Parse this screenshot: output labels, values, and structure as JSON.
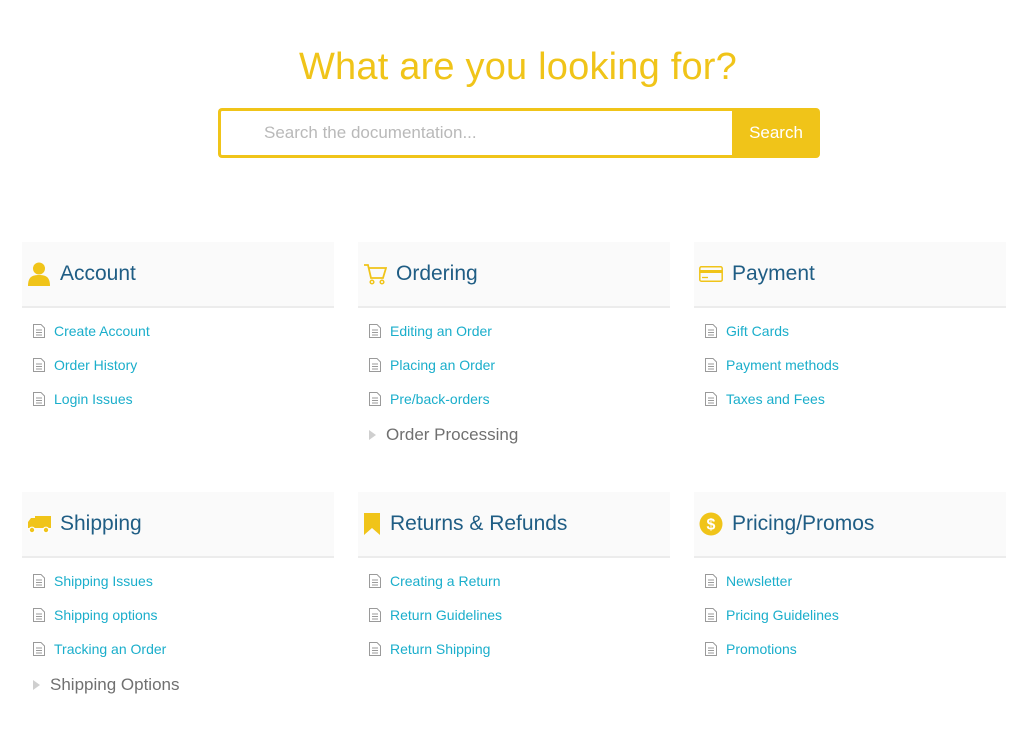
{
  "hero": {
    "title": "What are you looking for?",
    "search_placeholder": "Search the documentation...",
    "search_button": "Search"
  },
  "colors": {
    "accent": "#f0c419",
    "heading": "#1f5d84",
    "link": "#1aaecb",
    "muted": "#707070"
  },
  "categories": [
    {
      "title": "Account",
      "icon": "user-icon",
      "articles": [
        "Create Account",
        "Order History",
        "Login Issues"
      ]
    },
    {
      "title": "Ordering",
      "icon": "cart-icon",
      "articles": [
        "Editing an Order",
        "Placing an Order",
        "Pre/back-orders"
      ],
      "subsection": "Order Processing"
    },
    {
      "title": "Payment",
      "icon": "credit-card-icon",
      "articles": [
        "Gift Cards",
        "Payment methods",
        "Taxes and Fees"
      ]
    },
    {
      "title": "Shipping",
      "icon": "truck-icon",
      "articles": [
        "Shipping Issues",
        "Shipping options",
        "Tracking an Order"
      ],
      "subsection": "Shipping Options"
    },
    {
      "title": "Returns & Refunds",
      "icon": "bookmark-icon",
      "articles": [
        "Creating a Return",
        "Return Guidelines",
        "Return Shipping"
      ]
    },
    {
      "title": "Pricing/Promos",
      "icon": "dollar-coin-icon",
      "articles": [
        "Newsletter",
        "Pricing Guidelines",
        "Promotions"
      ]
    }
  ]
}
